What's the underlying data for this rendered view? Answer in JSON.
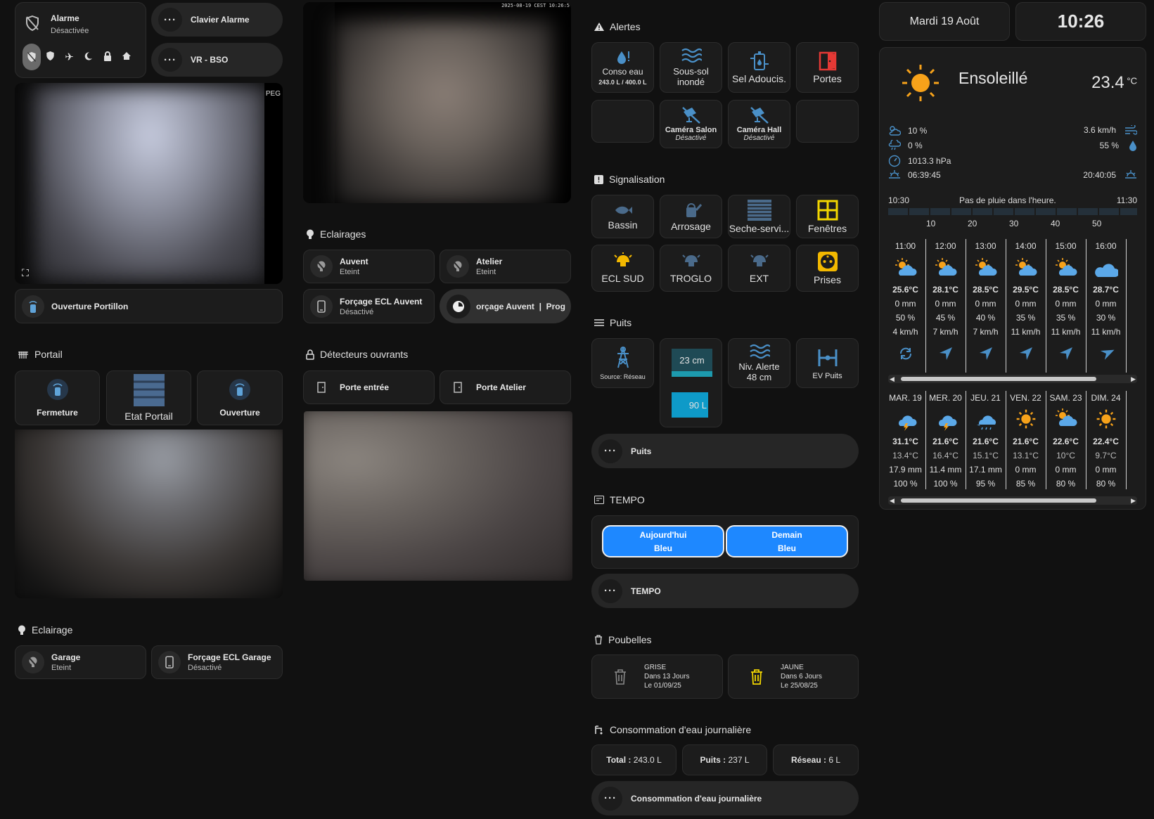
{
  "alarm": {
    "name": "Alarme",
    "state": "Désactivée"
  },
  "alarm_buttons": [
    "disarmed",
    "shield",
    "plane",
    "moon",
    "lock",
    "home"
  ],
  "pills_top": [
    {
      "label": "Clavier Alarme"
    },
    {
      "label": "VR - BSO"
    }
  ],
  "cam1_overlay": "PEG",
  "cam_main_timestamp": "2025-08-19 CEST 10:26:5",
  "portillon": {
    "label": "Ouverture Portillon"
  },
  "portail": {
    "title": "Portail",
    "buttons": [
      {
        "label": "Fermeture"
      },
      {
        "label": "Etat Portail"
      },
      {
        "label": "Ouverture"
      }
    ]
  },
  "eclairage_garage": {
    "title": "Eclairage",
    "items": [
      {
        "name": "Garage",
        "state": "Eteint"
      },
      {
        "name": "Forçage ECL Garage",
        "state": "Désactivé"
      }
    ]
  },
  "eclairages": {
    "title": "Eclairages",
    "items": [
      {
        "name": "Auvent",
        "state": "Eteint"
      },
      {
        "name": "Atelier",
        "state": "Eteint"
      },
      {
        "name": "Forçage ECL Auvent",
        "state": "Désactivé"
      }
    ],
    "marquee": "orçage Auvent  |  Prog"
  },
  "detecteurs": {
    "title": "Détecteurs ouvrants",
    "items": [
      {
        "name": "Porte entrée"
      },
      {
        "name": "Porte Atelier"
      }
    ]
  },
  "alertes": {
    "title": "Alertes",
    "conso_label": "Conso eau",
    "conso_value": "243.0 L / 400.0 L",
    "souslsol": "Sous-sol inondé",
    "sel": "Sel Adoucis.",
    "portes": "Portes",
    "cam_salon": {
      "name": "Caméra Salon",
      "state": "Désactivé"
    },
    "cam_hall": {
      "name": "Caméra Hall",
      "state": "Désactivé"
    }
  },
  "signalisation": {
    "title": "Signalisation",
    "items": [
      "Bassin",
      "Arrosage",
      "Seche-servi...",
      "Fenêtres",
      "ECL SUD",
      "TROGLO",
      "EXT",
      "Prises"
    ]
  },
  "puits": {
    "title": "Puits",
    "source": "Source: Réseau",
    "level_cm": "23 cm",
    "level_l": "90 L",
    "niv_alerte_label": "Niv. Alerte",
    "niv_alerte_value": "48 cm",
    "ev": "EV Puits",
    "pill": "Puits"
  },
  "tempo": {
    "title": "TEMPO",
    "today_label": "Aujourd'hui",
    "today_value": "Bleu",
    "tomorrow_label": "Demain",
    "tomorrow_value": "Bleu",
    "pill": "TEMPO"
  },
  "poubelles": {
    "title": "Poubelles",
    "items": [
      {
        "name": "GRISE",
        "in": "Dans 13 Jours",
        "date": "Le 01/09/25"
      },
      {
        "name": "JAUNE",
        "in": "Dans 6 Jours",
        "date": "Le 25/08/25"
      }
    ]
  },
  "conso": {
    "title": "Consommation d'eau journalière",
    "total_label": "Total :",
    "total_value": "243.0 L",
    "puits_label": "Puits :",
    "puits_value": "237 L",
    "reseau_label": "Réseau :",
    "reseau_value": "6 L",
    "pill": "Consommation d'eau journalière"
  },
  "date": "Mardi 19 Août",
  "time": "10:26",
  "weather": {
    "condition": "Ensoleillé",
    "temp": "23.4",
    "unit": "°C",
    "cloud": "10 %",
    "rain": "0 %",
    "pressure": "1013.3 hPa",
    "sunrise": "06:39:45",
    "wind": "3.6 km/h",
    "humidity": "55 %",
    "sunset": "20:40:05",
    "rain_start": "10:30",
    "rain_msg": "Pas de pluie dans l'heure.",
    "rain_end": "11:30",
    "rain_ticks": [
      "10",
      "20",
      "30",
      "40",
      "50"
    ],
    "hourly": [
      {
        "time": "11:00",
        "temp": "25.6°C",
        "mm": "0 mm",
        "pct": "50 %",
        "wind": "4 km/h"
      },
      {
        "time": "12:00",
        "temp": "28.1°C",
        "mm": "0 mm",
        "pct": "45 %",
        "wind": "7 km/h"
      },
      {
        "time": "13:00",
        "temp": "28.5°C",
        "mm": "0 mm",
        "pct": "40 %",
        "wind": "7 km/h"
      },
      {
        "time": "14:00",
        "temp": "29.5°C",
        "mm": "0 mm",
        "pct": "35 %",
        "wind": "11 km/h"
      },
      {
        "time": "15:00",
        "temp": "28.5°C",
        "mm": "0 mm",
        "pct": "35 %",
        "wind": "11 km/h"
      },
      {
        "time": "16:00",
        "temp": "28.7°C",
        "mm": "0 mm",
        "pct": "30 %",
        "wind": "11 km/h"
      }
    ],
    "daily": [
      {
        "day": "MAR. 19",
        "hi": "31.1°C",
        "lo": "13.4°C",
        "mm": "17.9 mm",
        "pct": "100 %",
        "icon": "storm"
      },
      {
        "day": "MER. 20",
        "hi": "21.6°C",
        "lo": "16.4°C",
        "mm": "11.4 mm",
        "pct": "100 %",
        "icon": "storm"
      },
      {
        "day": "JEU. 21",
        "hi": "21.6°C",
        "lo": "15.1°C",
        "mm": "17.1 mm",
        "pct": "95 %",
        "icon": "rain"
      },
      {
        "day": "VEN. 22",
        "hi": "21.6°C",
        "lo": "13.1°C",
        "mm": "0 mm",
        "pct": "85 %",
        "icon": "sun"
      },
      {
        "day": "SAM. 23",
        "hi": "22.6°C",
        "lo": "10°C",
        "mm": "0 mm",
        "pct": "80 %",
        "icon": "partly"
      },
      {
        "day": "DIM. 24",
        "hi": "22.4°C",
        "lo": "9.7°C",
        "mm": "0 mm",
        "pct": "80 %",
        "icon": "sun"
      }
    ]
  }
}
